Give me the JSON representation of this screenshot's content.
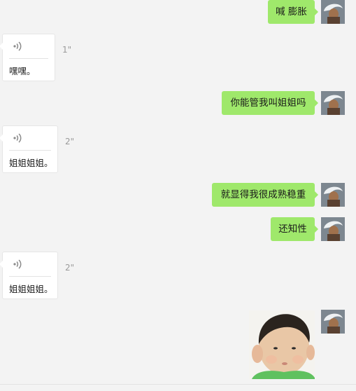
{
  "messages": {
    "m1": {
      "text": "喊 膨胀"
    },
    "m2": {
      "duration": "1\"",
      "transcript": "嘿嘿。"
    },
    "m3": {
      "text": "你能管我叫姐姐吗"
    },
    "m4": {
      "duration": "2\"",
      "transcript": "姐姐姐姐。"
    },
    "m5": {
      "text": "就显得我很成熟稳重"
    },
    "m6": {
      "text": "还知性"
    },
    "m7": {
      "duration": "2\"",
      "transcript": "姐姐姐姐。"
    },
    "m8": {
      "sticker": "baby-face-sticker"
    }
  },
  "icons": {
    "voice": "voice-wave-icon",
    "avatar": "user-avatar"
  },
  "colors": {
    "outgoing_bubble": "#9fe86b",
    "incoming_bubble": "#ffffff",
    "background": "#f3f3f3",
    "duration_text": "#9a9a9a"
  }
}
